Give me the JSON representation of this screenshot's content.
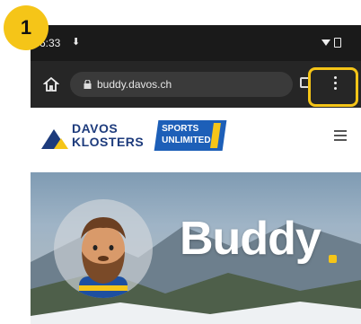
{
  "step": {
    "number": "1"
  },
  "status_bar": {
    "time": "6:33",
    "download_glyph": "⬇"
  },
  "browser": {
    "url": "buddy.davos.ch",
    "tab_count": ":",
    "icons": [
      "home-icon",
      "lock-icon",
      "tabs-icon",
      "more-vert-icon"
    ]
  },
  "site": {
    "logo_line1": "DAVOS",
    "logo_line2": "KLOSTERS",
    "sports_line1": "SPORTS",
    "sports_line2": "UNLIMITED",
    "hero_title": "Buddy"
  },
  "colors": {
    "highlight": "#f5c518",
    "brand_blue": "#1d3b7c",
    "sports_blue": "#1d5fb8",
    "accent_yellow": "#f5c518"
  }
}
